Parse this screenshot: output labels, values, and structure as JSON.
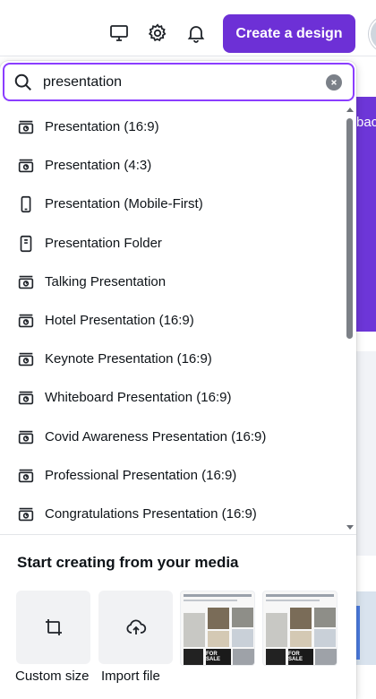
{
  "header": {
    "create_button": "Create a design"
  },
  "search": {
    "value": "presentation"
  },
  "background": {
    "partial_text": "bac"
  },
  "results": [
    {
      "label": "Presentation (16:9)",
      "icon": "presentation-icon"
    },
    {
      "label": "Presentation (4:3)",
      "icon": "presentation-icon"
    },
    {
      "label": "Presentation (Mobile-First)",
      "icon": "phone-icon"
    },
    {
      "label": "Presentation Folder",
      "icon": "document-icon"
    },
    {
      "label": "Talking Presentation",
      "icon": "presentation-icon"
    },
    {
      "label": "Hotel Presentation (16:9)",
      "icon": "presentation-icon"
    },
    {
      "label": "Keynote Presentation (16:9)",
      "icon": "presentation-icon"
    },
    {
      "label": "Whiteboard Presentation (16:9)",
      "icon": "presentation-icon"
    },
    {
      "label": "Covid Awareness Presentation (16:9)",
      "icon": "presentation-icon"
    },
    {
      "label": "Professional Presentation (16:9)",
      "icon": "presentation-icon"
    },
    {
      "label": "Congratulations Presentation (16:9)",
      "icon": "presentation-icon"
    }
  ],
  "media": {
    "title": "Start creating from your media",
    "custom_size": "Custom size",
    "import_file": "Import file",
    "thumb_text": "FOR SALE"
  },
  "colors": {
    "accent": "#6d30d6",
    "search_border": "#8b3dff"
  }
}
